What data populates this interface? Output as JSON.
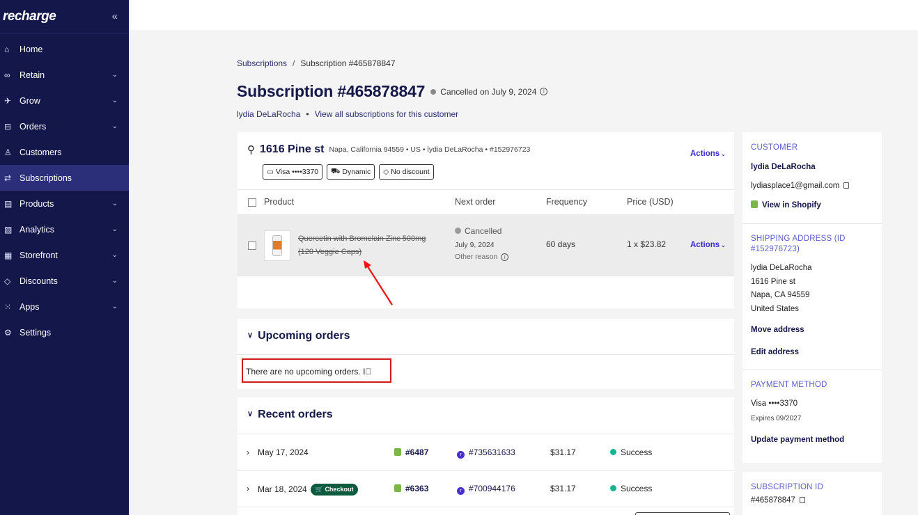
{
  "sidebar": {
    "logo": "recharge",
    "collapse_icon": "«",
    "items": [
      {
        "label": "Home",
        "icon": "⌂",
        "chevron": ""
      },
      {
        "label": "Retain",
        "icon": "∞",
        "chevron": "⌄"
      },
      {
        "label": "Grow",
        "icon": "✈",
        "chevron": "⌄"
      },
      {
        "label": "Orders",
        "icon": "⊟",
        "chevron": "⌄"
      },
      {
        "label": "Customers",
        "icon": "♙",
        "chevron": ""
      },
      {
        "label": "Subscriptions",
        "icon": "⇄",
        "chevron": ""
      },
      {
        "label": "Products",
        "icon": "▤",
        "chevron": "⌄"
      },
      {
        "label": "Analytics",
        "icon": "▨",
        "chevron": "⌄"
      },
      {
        "label": "Storefront",
        "icon": "▦",
        "chevron": "⌄"
      },
      {
        "label": "Discounts",
        "icon": "◇",
        "chevron": "⌄"
      },
      {
        "label": "Apps",
        "icon": "⁙",
        "chevron": "⌄"
      },
      {
        "label": "Settings",
        "icon": "⚙",
        "chevron": ""
      }
    ]
  },
  "breadcrumb": {
    "parent": "Subscriptions",
    "separator": "/",
    "current": "Subscription #465878847"
  },
  "header": {
    "title": "Subscription #465878847",
    "status": "Cancelled on July 9, 2024",
    "customer_name": "lydia DeLaRocha",
    "dot": "•",
    "view_all": "View all subscriptions for this customer"
  },
  "address_card": {
    "street": "1616 Pine st",
    "meta": "Napa, California 94559  •  US  •  lydia DeLaRocha  •  #152976723",
    "chips": [
      "Visa ••••3370",
      "Dynamic",
      "No discount"
    ],
    "actions_label": "Actions"
  },
  "product_table": {
    "headers": [
      "Product",
      "Next order",
      "Frequency",
      "Price (USD)"
    ],
    "row": {
      "name": "Quercetin with Bromelain Zinc 500mg (120 Veggie Caps)",
      "status": "Cancelled",
      "date": "July 9, 2024",
      "reason": "Other reason",
      "frequency": "60 days",
      "price": "1 x $23.82",
      "actions_label": "Actions"
    }
  },
  "upcoming": {
    "title": "Upcoming orders",
    "empty_text": "There are no upcoming orders. I⃞"
  },
  "recent": {
    "title": "Recent orders",
    "orders": [
      {
        "date": "May 17, 2024",
        "badge": "",
        "order": "#6487",
        "charge": "#735631633",
        "amount": "$31.17",
        "status": "Success"
      },
      {
        "date": "Mar 18, 2024",
        "badge": "Checkout",
        "order": "#6363",
        "charge": "#700944176",
        "amount": "$31.17",
        "status": "Success"
      }
    ]
  },
  "customer_panel": {
    "label": "CUSTOMER",
    "name": "lydia DeLaRocha",
    "email": "lydiasplace1@gmail.com",
    "view_shopify": "View in Shopify"
  },
  "shipping_panel": {
    "label": "SHIPPING ADDRESS (ID #152976723)",
    "lines": [
      "lydia DeLaRocha",
      "1616 Pine st",
      "Napa, CA 94559",
      "United States"
    ],
    "move": "Move address",
    "edit": "Edit address"
  },
  "payment_panel": {
    "label": "PAYMENT METHOD",
    "card": "Visa ••••3370",
    "expires": "Expires 09/2027",
    "update": "Update payment method"
  },
  "subscription_panel": {
    "label": "SUBSCRIPTION ID",
    "id": "#465878847"
  },
  "colors": {
    "sidebar": "#14174a",
    "accent": "#3b2fc9",
    "success": "#17b58f",
    "annotation": "#d11a1a"
  }
}
